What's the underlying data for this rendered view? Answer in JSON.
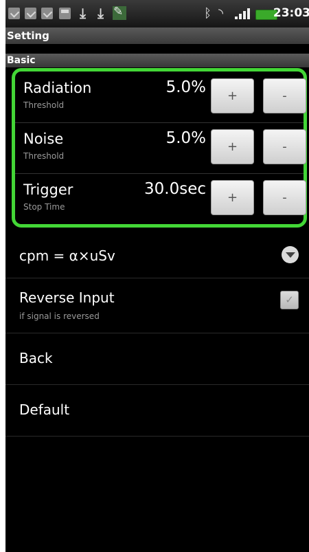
{
  "status_bar": {
    "time": "23:03",
    "icons": [
      "checkbox-icon",
      "checkbox-icon",
      "checkbox-icon",
      "sd-card-icon",
      "download-icon",
      "download-icon",
      "app-icon",
      "bluetooth-icon",
      "wifi-icon",
      "signal-icon",
      "battery-icon"
    ]
  },
  "header": {
    "title": "Setting"
  },
  "section": {
    "title": "Basic"
  },
  "thresholds": [
    {
      "label": "Radiation",
      "sublabel": "Threshold",
      "value": "5.0%",
      "plus": "+",
      "minus": "-"
    },
    {
      "label": "Noise",
      "sublabel": "Threshold",
      "value": "5.0%",
      "plus": "+",
      "minus": "-"
    },
    {
      "label": "Trigger",
      "sublabel": "Stop Time",
      "value": "30.0sec",
      "plus": "+",
      "minus": "-"
    }
  ],
  "formula": {
    "label": "cpm = α×uSv"
  },
  "reverse_input": {
    "label": "Reverse Input",
    "sublabel": "if signal is reversed"
  },
  "back": {
    "label": "Back"
  },
  "default": {
    "label": "Default"
  },
  "colors": {
    "accent": "#43d636",
    "background": "#000000"
  }
}
